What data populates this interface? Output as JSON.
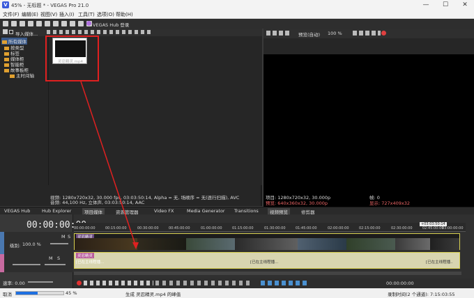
{
  "window": {
    "title": "45% - 无标题 * - VEGAS Pro 21.0",
    "logo_letter": "V",
    "minimize": "—",
    "maximize": "☐",
    "close": "✕"
  },
  "menu": [
    "文件(F)",
    "编辑(E)",
    "视图(V)",
    "插入(I)",
    "工具(T)",
    "选项(O)",
    "帮助(H)"
  ],
  "toolbar": {
    "hub_label": "VEGAS Hub 登录"
  },
  "explorer": {
    "import_label": "导入媒体...",
    "tree": [
      {
        "label": "所有媒体",
        "selected": true
      },
      {
        "label": "按类型"
      },
      {
        "label": "标签"
      },
      {
        "label": "媒体柜"
      },
      {
        "label": "智能柜"
      },
      {
        "label": "故事板柜"
      },
      {
        "label": "主时间轴"
      }
    ],
    "thumb_label": "灵忍精灵.mp4",
    "info_line1": "视频: 1280x720x32, 30.000 fps, 03:03:50:14, Alpha = 无, 场顺序 = 无(逐行扫描), AVC",
    "info_line2": "音频: 44,100 Hz, 立体声, 03:03:50:14, AAC"
  },
  "preview": {
    "mode_label": "预览(自动)",
    "zoom_label": "100 %",
    "project_line": "项目: 1280x720x32, 30.000p",
    "preview_line": "预览: 640x360x32, 30.000p",
    "frame_line": "帧:   0",
    "display_line": "显示: 727x409x32"
  },
  "tabs": [
    "VEGAS Hub",
    "Hub Explorer",
    "项目媒体",
    "资源管理器",
    "Video FX",
    "Media Generator",
    "Transitions",
    "视频预览",
    "修剪器"
  ],
  "timeline": {
    "timecode": "00:00:00:00",
    "track1_label": "级别:",
    "track1_value": "100.0 %",
    "track2_vol": "M",
    "track2_solo": "S",
    "track1_mute": "M",
    "track1_solo": "S",
    "rate_label": "速率: 0.00",
    "ruler": [
      "00:00:00:00",
      "00:15:00:00",
      "00:30:00:00",
      "00:45:00:00",
      "01:00:00:00",
      "01:15:00:00",
      "01:30:00:00",
      "01:45:00:00",
      "02:00:00:00",
      "02:15:00:00",
      "02:30:00:00",
      "02:45:00:00",
      "03:00:00:00"
    ],
    "end_marker": "+03:03:50:14",
    "clip_name": "灵忍精灵",
    "audio_clip_text": "[已在主线程播...",
    "audio_mid_text": "[已在主线程播...",
    "audio_end_text": "[已在主线程播..",
    "cursor_time": "00:00:00:00"
  },
  "status": {
    "left": "取消",
    "progress_pct": 45,
    "progress_text": "45 %",
    "middle": "生成 灵忍精灵.mp4 的峰值",
    "right": "录制时间(2 个通道): 7:15:03:55"
  },
  "colors": {
    "accent": "#3b5bdb",
    "highlight": "#e02020",
    "track_video": "#4a78b0",
    "track_audio": "#c86aa0",
    "clip_border": "#d8d050"
  }
}
